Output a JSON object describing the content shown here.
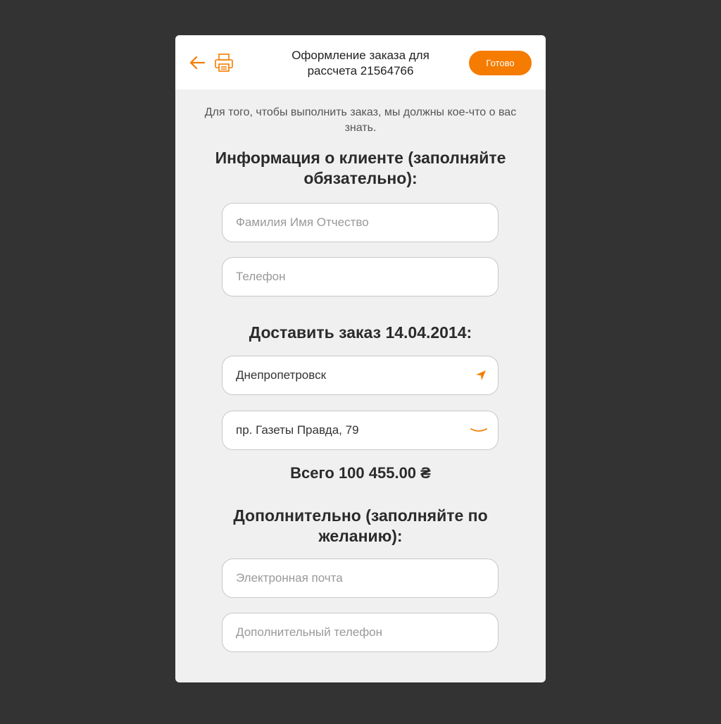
{
  "header": {
    "title": "Оформление заказа для рассчета 21564766",
    "done_label": "Готово",
    "back_icon": "arrow-left-icon",
    "print_icon": "printer-icon"
  },
  "intro": "Для того, чтобы выполнить заказ, мы должны кое-что о вас знать.",
  "client_section": {
    "title": "Информация о клиенте (заполняйте обязательно):",
    "name_placeholder": "Фамилия Имя Отчество",
    "phone_placeholder": "Телефон"
  },
  "delivery_section": {
    "title": "Доставить заказ 14.04.2014:",
    "city_value": "Днепропетровск",
    "city_icon": "location-arrow-icon",
    "address_value": "пр. Газеты Правда, 79",
    "address_icon": "chevron-down-icon"
  },
  "total": "Всего 100 455.00 ₴",
  "extra_section": {
    "title": "Дополнительно (заполняйте по желанию):",
    "email_placeholder": "Электронная почта",
    "extra_phone_placeholder": "Дополнительный телефон"
  },
  "colors": {
    "accent": "#f57c00",
    "background": "#333333",
    "card": "#f0f0f0"
  }
}
